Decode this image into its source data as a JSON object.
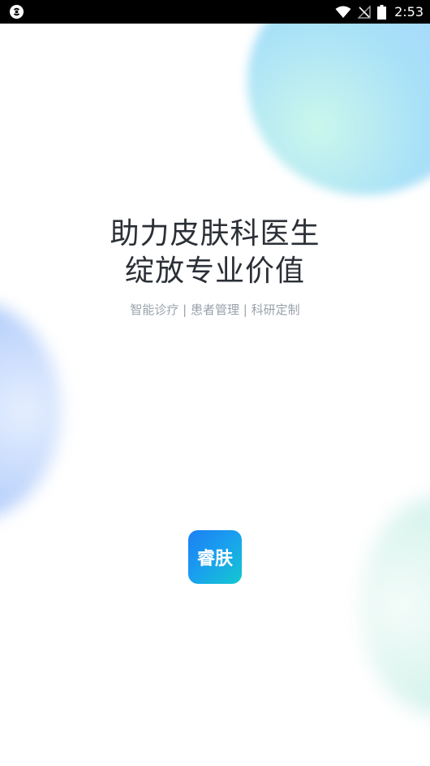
{
  "status_bar": {
    "time": "2:53",
    "icons": [
      "app-notification-icon",
      "wifi-icon",
      "no-signal-icon",
      "battery-icon"
    ]
  },
  "splash": {
    "headline_line1": "助力皮肤科医生",
    "headline_line2": "绽放专业价值",
    "subtitle": "智能诊疗 | 患者管理 | 科研定制",
    "logo_text": "睿肤"
  },
  "colors": {
    "logo_gradient_start": "#1c7ff2",
    "logo_gradient_end": "#13c8cf",
    "headline": "#2b2f36",
    "subtitle": "#9aa1ab"
  }
}
